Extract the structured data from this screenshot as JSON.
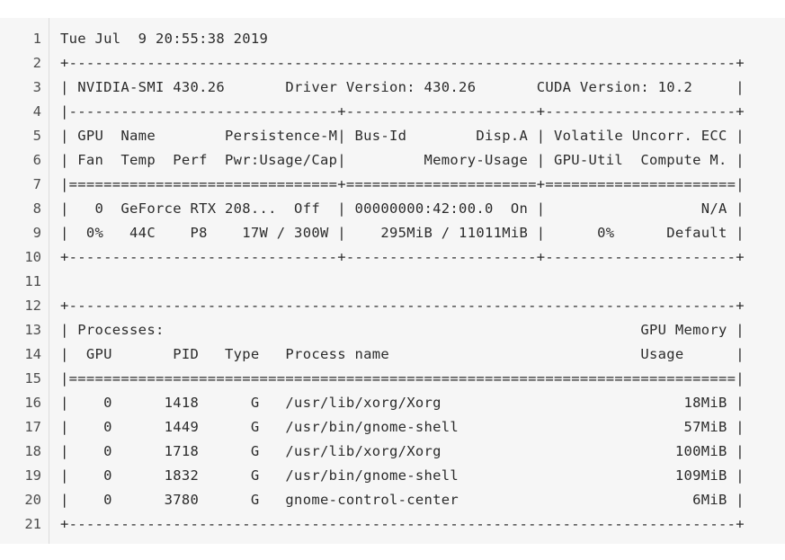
{
  "code_block": {
    "lines": [
      {
        "number": "1",
        "text": "Tue Jul  9 20:55:38 2019"
      },
      {
        "number": "2",
        "text": "+-----------------------------------------------------------------------------+"
      },
      {
        "number": "3",
        "text": "| NVIDIA-SMI 430.26       Driver Version: 430.26       CUDA Version: 10.2     |"
      },
      {
        "number": "4",
        "text": "|-------------------------------+----------------------+----------------------+"
      },
      {
        "number": "5",
        "text": "| GPU  Name        Persistence-M| Bus-Id        Disp.A | Volatile Uncorr. ECC |"
      },
      {
        "number": "6",
        "text": "| Fan  Temp  Perf  Pwr:Usage/Cap|         Memory-Usage | GPU-Util  Compute M. |"
      },
      {
        "number": "7",
        "text": "|===============================+======================+======================|"
      },
      {
        "number": "8",
        "text": "|   0  GeForce RTX 208...  Off  | 00000000:42:00.0  On |                  N/A |"
      },
      {
        "number": "9",
        "text": "|  0%   44C    P8    17W / 300W |    295MiB / 11011MiB |      0%      Default |"
      },
      {
        "number": "10",
        "text": "+-------------------------------+----------------------+----------------------+"
      },
      {
        "number": "11",
        "text": ""
      },
      {
        "number": "12",
        "text": "+-----------------------------------------------------------------------------+"
      },
      {
        "number": "13",
        "text": "| Processes:                                                       GPU Memory |"
      },
      {
        "number": "14",
        "text": "|  GPU       PID   Type   Process name                             Usage      |"
      },
      {
        "number": "15",
        "text": "|=============================================================================|"
      },
      {
        "number": "16",
        "text": "|    0      1418      G   /usr/lib/xorg/Xorg                            18MiB |"
      },
      {
        "number": "17",
        "text": "|    0      1449      G   /usr/bin/gnome-shell                          57MiB |"
      },
      {
        "number": "18",
        "text": "|    0      1718      G   /usr/lib/xorg/Xorg                           100MiB |"
      },
      {
        "number": "19",
        "text": "|    0      1832      G   /usr/bin/gnome-shell                         109MiB |"
      },
      {
        "number": "20",
        "text": "|    0      3780      G   gnome-control-center                           6MiB |"
      },
      {
        "number": "21",
        "text": "+-----------------------------------------------------------------------------+"
      }
    ]
  },
  "colors": {
    "background": "#f6f6f6",
    "text": "#2b2b2b",
    "line_number": "#4d4d4d",
    "gutter_border": "#dcdcdc"
  }
}
